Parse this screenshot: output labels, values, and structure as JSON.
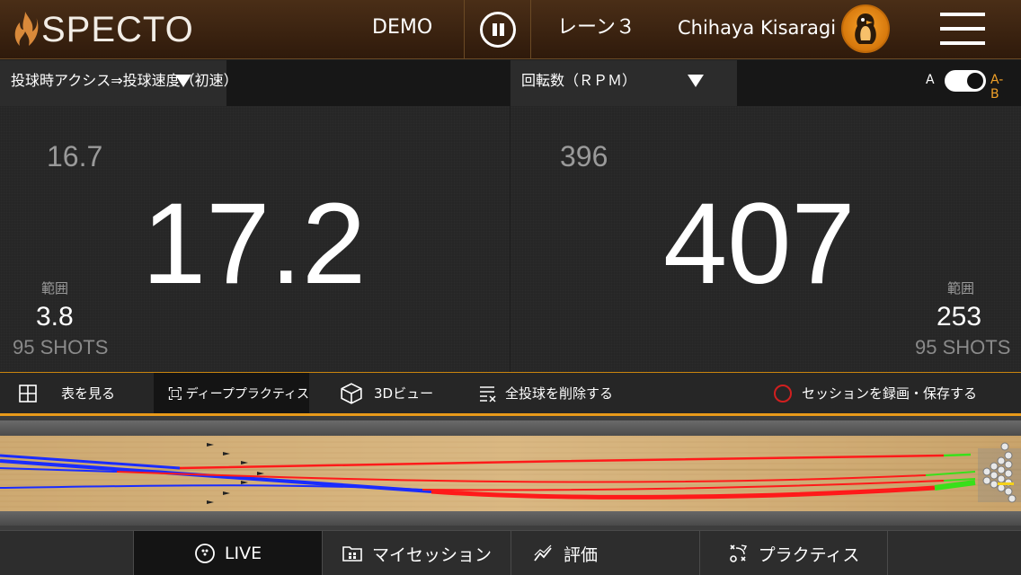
{
  "header": {
    "logo_text": "SPECTO",
    "mode": "DEMO",
    "lane": "レーン３",
    "user": "Chihaya Kisaragi"
  },
  "selectors": {
    "left_metric": "投球時アクシス⇒投球速度（初速）",
    "right_metric": "回転数（ＲＰＭ）",
    "toggle_a": "A",
    "toggle_ab": "A-B"
  },
  "panels": {
    "left": {
      "previous": "16.7",
      "current": "17.2",
      "range_label": "範囲",
      "range_value": "3.8",
      "shots": "95 SHOTS"
    },
    "right": {
      "previous": "396",
      "current": "407",
      "range_label": "範囲",
      "range_value": "253",
      "shots": "95 SHOTS"
    }
  },
  "toolbar": {
    "view_table": "表を見る",
    "deep_practice": "ディーププラクティス",
    "view_3d": "3Dビュー",
    "delete_all": "全投球を削除する",
    "record_session": "セッションを録画・保存する"
  },
  "bottom_nav": {
    "live": "LIVE",
    "my_session": "マイセッション",
    "evaluation": "評価",
    "practice": "プラクティス"
  },
  "colors": {
    "accent": "#e89a1a",
    "record_red": "#d11f1f",
    "trajectory_blue": "#1a2cff",
    "trajectory_red": "#ff1a1a",
    "trajectory_green": "#39e01a"
  }
}
